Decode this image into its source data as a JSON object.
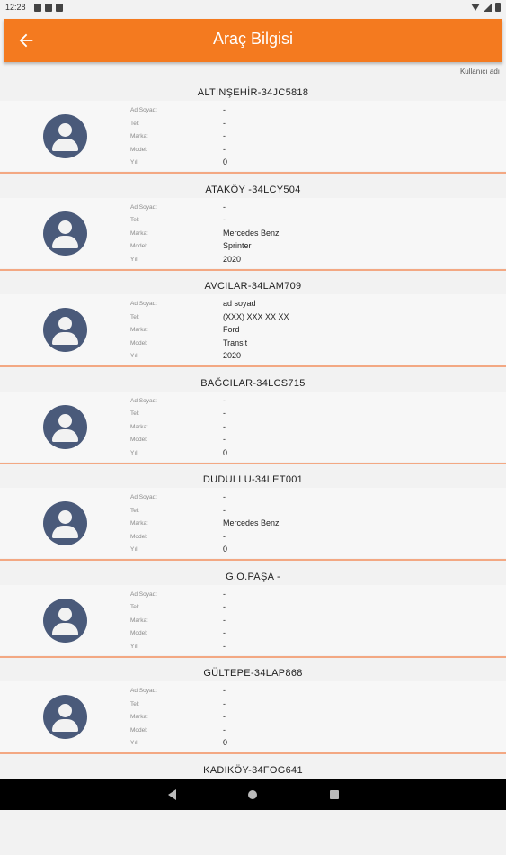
{
  "status_bar": {
    "time": "12:28"
  },
  "app_bar": {
    "title": "Araç Bilgisi",
    "back_icon": "arrow-left-icon",
    "color": "#f47a1f"
  },
  "user": {
    "label": "Kullanıcı adı"
  },
  "field_labels": {
    "name": "Ad Soyad:",
    "phone": "Tel:",
    "brand": "Marka:",
    "model": "Model:",
    "year": "Yıl:"
  },
  "vehicles": [
    {
      "title": "ALTINŞEHİR-34JC5818",
      "name": "-",
      "phone": "-",
      "brand": "-",
      "model": "-",
      "year": "0"
    },
    {
      "title": "ATAKÖY -34LCY504",
      "name": "-",
      "phone": "-",
      "brand": "Mercedes Benz",
      "model": "Sprinter",
      "year": "2020"
    },
    {
      "title": "AVCILAR-34LAM709",
      "name": "ad soyad",
      "phone": "(XXX) XXX XX XX",
      "brand": "Ford",
      "model": "Transit",
      "year": "2020"
    },
    {
      "title": "BAĞCILAR-34LCS715",
      "name": "-",
      "phone": "-",
      "brand": "-",
      "model": "-",
      "year": "0"
    },
    {
      "title": "DUDULLU-34LET001",
      "name": "-",
      "phone": "-",
      "brand": "Mercedes Benz",
      "model": "-",
      "year": "0"
    },
    {
      "title": "G.O.PAŞA -",
      "name": "-",
      "phone": "-",
      "brand": "-",
      "model": "-",
      "year": "-"
    },
    {
      "title": "GÜLTEPE-34LAP868",
      "name": "-",
      "phone": "-",
      "brand": "-",
      "model": "-",
      "year": "0"
    },
    {
      "title": "KADIKÖY-34FOG641"
    }
  ]
}
